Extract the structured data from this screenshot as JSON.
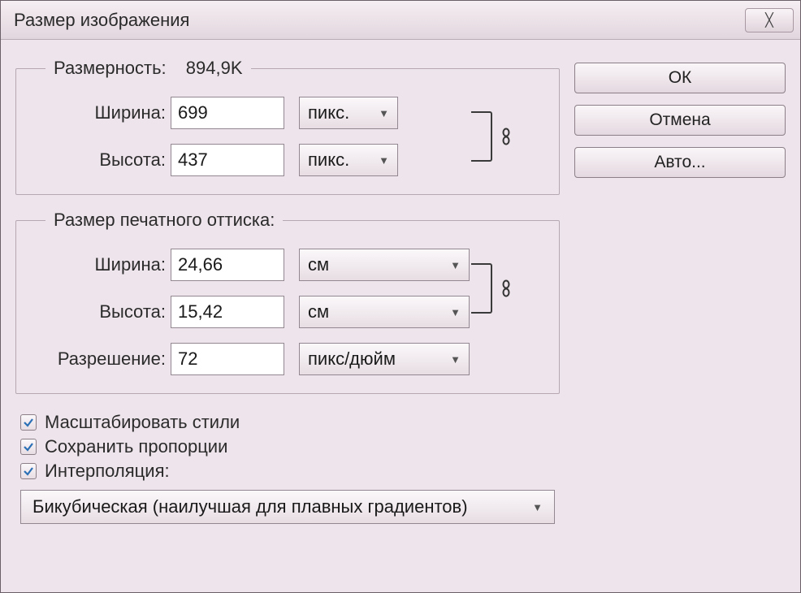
{
  "window": {
    "title": "Размер изображения"
  },
  "buttons": {
    "ok": "ОК",
    "cancel": "Отмена",
    "auto": "Авто..."
  },
  "pixel_dims": {
    "legend": "Размерность:",
    "size_readout": "894,9K",
    "width_label": "Ширина:",
    "width_value": "699",
    "width_unit": "пикс.",
    "height_label": "Высота:",
    "height_value": "437",
    "height_unit": "пикс."
  },
  "print_size": {
    "legend": "Размер печатного оттиска:",
    "width_label": "Ширина:",
    "width_value": "24,66",
    "width_unit": "см",
    "height_label": "Высота:",
    "height_value": "15,42",
    "height_unit": "см",
    "res_label": "Разрешение:",
    "res_value": "72",
    "res_unit": "пикс/дюйм"
  },
  "options": {
    "scale_styles": "Масштабировать стили",
    "constrain": "Сохранить пропорции",
    "resample": "Интерполяция:"
  },
  "resample_method": "Бикубическая (наилучшая для плавных градиентов)"
}
